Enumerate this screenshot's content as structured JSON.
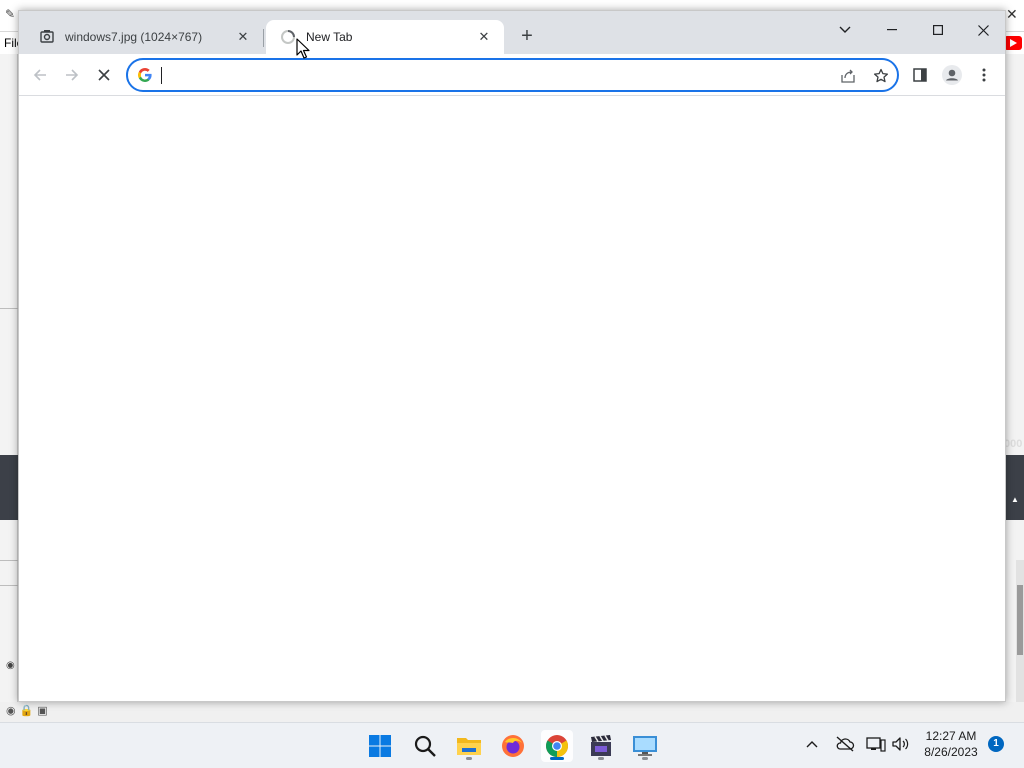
{
  "background_app": {
    "menu_file": "File",
    "right_number": "000"
  },
  "browser": {
    "tabs": [
      {
        "title": "windows7.jpg (1024×767)",
        "active": false,
        "favicon": "image-viewer-icon"
      },
      {
        "title": "New Tab",
        "active": true,
        "favicon": "loading-icon"
      }
    ],
    "new_tab_label": "+",
    "omnibox": {
      "value": "",
      "placeholder": ""
    },
    "page_state": "loading"
  },
  "taskbar": {
    "apps": [
      {
        "name": "start-button",
        "icon": "windows-logo-icon",
        "running": false
      },
      {
        "name": "search-button",
        "icon": "search-icon",
        "running": false
      },
      {
        "name": "file-explorer",
        "icon": "folder-icon",
        "running": true
      },
      {
        "name": "firefox",
        "icon": "firefox-icon",
        "running": false
      },
      {
        "name": "chrome",
        "icon": "chrome-icon",
        "running": true,
        "active": true
      },
      {
        "name": "video-editor",
        "icon": "film-clapper-icon",
        "running": true
      },
      {
        "name": "remote-desktop",
        "icon": "monitor-icon",
        "running": false
      }
    ],
    "clock": {
      "time": "12:27 AM",
      "date": "8/26/2023"
    },
    "notification_count": "1"
  },
  "colors": {
    "accent": "#1a73e8",
    "tabstrip": "#dee1e6",
    "taskbar": "#eef1f5",
    "windows_blue": "#0067c0"
  }
}
